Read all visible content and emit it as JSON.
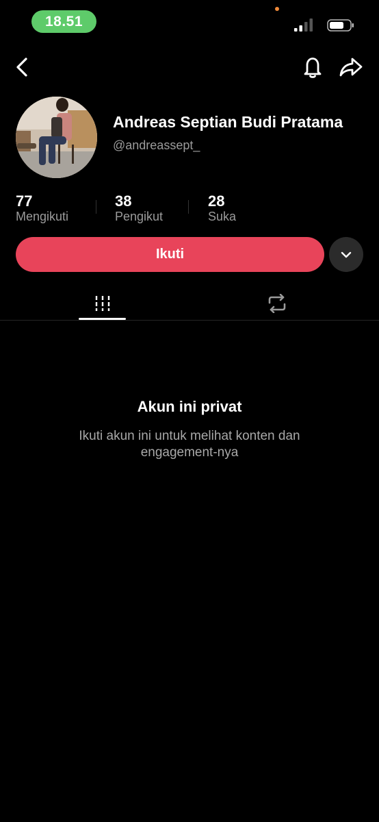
{
  "status_bar": {
    "time": "18.51"
  },
  "profile": {
    "display_name": "Andreas Septian Budi Pratama",
    "username": "@andreassept_"
  },
  "stats": [
    {
      "value": "77",
      "label": "Mengikuti"
    },
    {
      "value": "38",
      "label": "Pengikut"
    },
    {
      "value": "28",
      "label": "Suka"
    }
  ],
  "actions": {
    "follow_label": "Ikuti"
  },
  "private_notice": {
    "title": "Akun ini privat",
    "subtitle": "Ikuti akun ini untuk melihat konten dan engagement-nya"
  },
  "icons": {
    "back": "chevron-left-icon",
    "notification": "bell-icon",
    "share": "share-arrow-icon",
    "more": "chevron-down-icon",
    "videos_tab": "grid-icon",
    "reposts_tab": "repost-icon"
  },
  "colors": {
    "follow_button": "#e8445a",
    "time_pill": "#5ecb6a",
    "background": "#000000"
  }
}
